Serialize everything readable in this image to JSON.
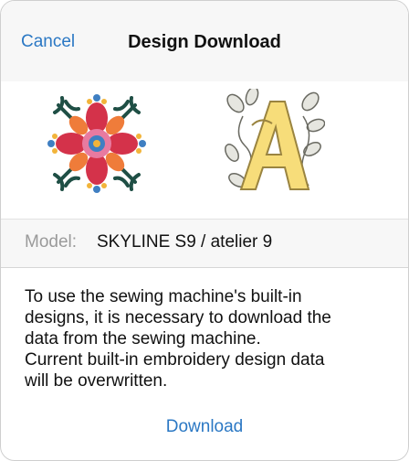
{
  "header": {
    "cancel_label": "Cancel",
    "title": "Design Download"
  },
  "preview": {
    "designs": [
      "floral-cross-embroidery-design",
      "ornamental-letter-a-embroidery-design"
    ]
  },
  "model": {
    "label": "Model:",
    "value": "SKYLINE S9 / atelier 9"
  },
  "message": {
    "line1": "To use the sewing machine's built-in",
    "line2": "designs, it is necessary to download the",
    "line3": "data from the sewing machine.",
    "line4": "Current built-in embroidery design data",
    "line5": "will be overwritten."
  },
  "actions": {
    "download_label": "Download"
  },
  "colors": {
    "accent": "#2b78c4",
    "header_bg": "#f7f7f7"
  }
}
